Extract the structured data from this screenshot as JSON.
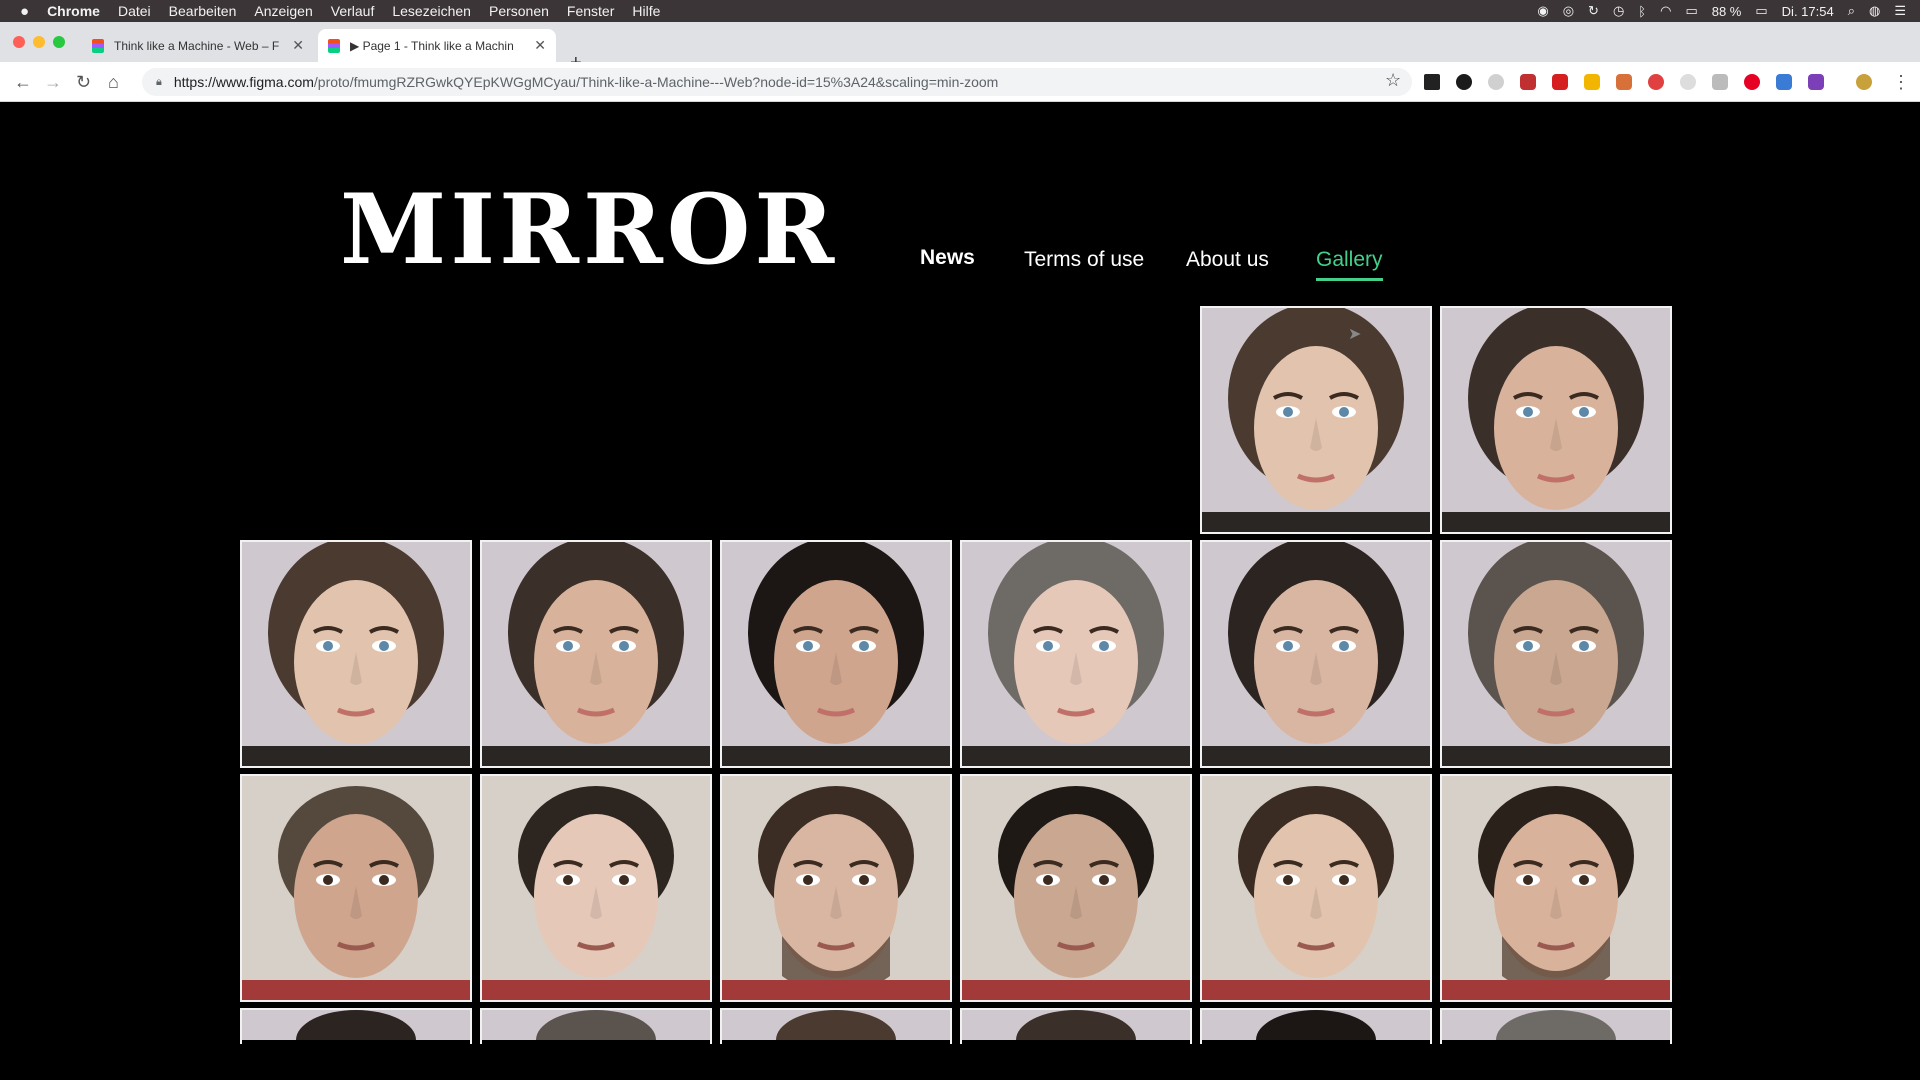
{
  "menubar": {
    "apple_icon": "apple-icon",
    "items": [
      "Chrome",
      "Datei",
      "Bearbeiten",
      "Anzeigen",
      "Verlauf",
      "Lesezeichen",
      "Personen",
      "Fenster",
      "Hilfe"
    ],
    "battery": "88 %",
    "clock": "Di. 17:54"
  },
  "tabs": [
    {
      "title": "Think like a Machine - Web – F",
      "active": false
    },
    {
      "title": "▶ Page 1 - Think like a Machin",
      "active": true
    }
  ],
  "new_tab_label": "+",
  "address": {
    "host": "https://www.figma.com",
    "path": "/proto/fmumgRZRGwkQYEpKWGgMCyau/Think-like-a-Machine---Web?node-id=15%3A24&scaling=min-zoom"
  },
  "site": {
    "logo": "MIRROR",
    "nav": [
      {
        "label": "News",
        "active": false
      },
      {
        "label": "Terms of use",
        "active": false
      },
      {
        "label": "About us",
        "active": false
      },
      {
        "label": "Gallery",
        "active": true
      }
    ]
  },
  "gallery": {
    "accent_color": "#44d08b",
    "row1_count": 2,
    "rows": [
      {
        "type": "female"
      },
      {
        "type": "male"
      },
      {
        "type": "partial"
      }
    ]
  }
}
